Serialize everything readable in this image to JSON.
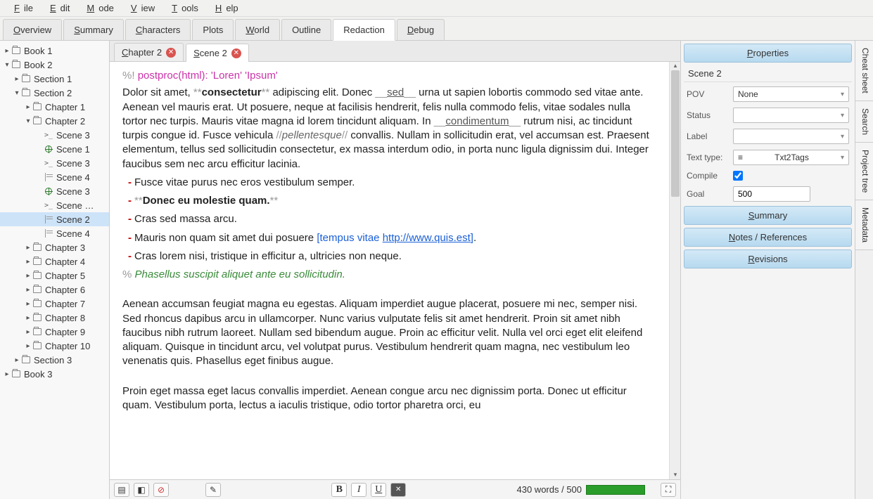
{
  "menu": [
    "File",
    "Edit",
    "Mode",
    "View",
    "Tools",
    "Help"
  ],
  "mainTabs": [
    "Overview",
    "Summary",
    "Characters",
    "Plots",
    "World",
    "Outline",
    "Redaction",
    "Debug"
  ],
  "activeMainTab": 6,
  "tree": [
    {
      "d": 0,
      "exp": "▸",
      "ico": "folder",
      "label": "Book 1"
    },
    {
      "d": 0,
      "exp": "▾",
      "ico": "folder",
      "label": "Book 2"
    },
    {
      "d": 1,
      "exp": "▸",
      "ico": "folder",
      "label": "Section 1"
    },
    {
      "d": 1,
      "exp": "▾",
      "ico": "folder",
      "label": "Section 2"
    },
    {
      "d": 2,
      "exp": "▸",
      "ico": "folder",
      "label": "Chapter 1"
    },
    {
      "d": 2,
      "exp": "▾",
      "ico": "folder",
      "label": "Chapter 2"
    },
    {
      "d": 3,
      "exp": "",
      "ico": "prompt",
      "label": "Scene 3"
    },
    {
      "d": 3,
      "exp": "",
      "ico": "globe",
      "label": "Scene 1"
    },
    {
      "d": 3,
      "exp": "",
      "ico": "prompt",
      "label": "Scene 3"
    },
    {
      "d": 3,
      "exp": "",
      "ico": "lined",
      "label": "Scene 4"
    },
    {
      "d": 3,
      "exp": "",
      "ico": "globe",
      "label": "Scene 3"
    },
    {
      "d": 3,
      "exp": "",
      "ico": "prompt",
      "label": "Scene …"
    },
    {
      "d": 3,
      "exp": "",
      "ico": "lined",
      "label": "Scene 2",
      "sel": true
    },
    {
      "d": 3,
      "exp": "",
      "ico": "lined",
      "label": "Scene 4"
    },
    {
      "d": 2,
      "exp": "▸",
      "ico": "folder",
      "label": "Chapter 3"
    },
    {
      "d": 2,
      "exp": "▸",
      "ico": "folder",
      "label": "Chapter 4"
    },
    {
      "d": 2,
      "exp": "▸",
      "ico": "folder",
      "label": "Chapter 5"
    },
    {
      "d": 2,
      "exp": "▸",
      "ico": "folder",
      "label": "Chapter 6"
    },
    {
      "d": 2,
      "exp": "▸",
      "ico": "folder",
      "label": "Chapter 7"
    },
    {
      "d": 2,
      "exp": "▸",
      "ico": "folder",
      "label": "Chapter 8"
    },
    {
      "d": 2,
      "exp": "▸",
      "ico": "folder",
      "label": "Chapter 9"
    },
    {
      "d": 2,
      "exp": "▸",
      "ico": "folder",
      "label": "Chapter 10"
    },
    {
      "d": 1,
      "exp": "▸",
      "ico": "folder",
      "label": "Section 3"
    },
    {
      "d": 0,
      "exp": "▸",
      "ico": "folder",
      "label": "Book 3"
    }
  ],
  "editorTabs": [
    {
      "label": "Chapter 2",
      "active": false
    },
    {
      "label": "Scene 2",
      "active": true
    }
  ],
  "content": {
    "postproc_pre": "%! ",
    "postproc": "postproc(html): 'Loren' 'Ipsum'",
    "p1_a": "    Dolor sit amet, ",
    "p1_stars1": "**",
    "p1_bold": "consectetur",
    "p1_stars2": "**",
    "p1_b": " adipiscing elit. Donec ",
    "p1_u1": "__",
    "p1_sed": "sed",
    "p1_u2": "__",
    "p1_c": " urna ut sapien lobortis commodo sed vitae ante. Aenean vel mauris erat. Ut posuere, neque at facilisis hendrerit, felis nulla commodo felis, vitae sodales nulla tortor nec turpis. Mauris vitae magna id lorem tincidunt aliquam. In ",
    "p1_u3": "__",
    "p1_cond": "condimentum",
    "p1_u4": "__",
    "p1_d": " rutrum nisi, ac tincidunt turpis congue id. Fusce vehicula ",
    "p1_sl1": "//",
    "p1_it": "pellentesque",
    "p1_sl2": "//",
    "p1_e": " convallis. Nullam in sollicitudin erat, vel accumsan est. Praesent elementum, tellus sed sollicitudin consectetur, ex massa interdum odio, in porta nunc ligula dignissim dui. Integer faucibus sem nec arcu efficitur lacinia.",
    "b1": "Fusce vitae purus nec eros vestibulum semper.",
    "b2_s1": "**",
    "b2_bold": "Donec eu molestie quam.",
    "b2_s2": "**",
    "b3": "Cras sed massa arcu.",
    "b4_a": "Mauris non quam sit amet dui posuere ",
    "b4_br": "[",
    "b4_txt": "tempus vitae ",
    "b4_link": "http://www.quis.est",
    "b4_br2": "]",
    "b4_dot": ".",
    "b5": "Cras lorem nisi, tristique in efficitur a, ultricies non neque.",
    "comment_pre": "% ",
    "comment": "Phasellus suscipit aliquet ante eu sollicitudin.",
    "p2": "    Aenean accumsan feugiat magna eu egestas. Aliquam imperdiet augue placerat, posuere mi nec, semper nisi. Sed rhoncus dapibus arcu in ullamcorper. Nunc varius vulputate felis sit amet hendrerit. Proin sit amet nibh faucibus nibh rutrum laoreet. Nullam sed bibendum augue. Proin ac efficitur velit. Nulla vel orci eget elit eleifend aliquam. Quisque in tincidunt arcu, vel volutpat purus. Vestibulum hendrerit quam magna, nec vestibulum leo venenatis quis. Phasellus eget finibus augue.",
    "p3": "    Proin eget massa eget lacus convallis imperdiet. Aenean congue arcu nec dignissim porta. Donec ut efficitur quam. Vestibulum porta, lectus a iaculis tristique, odio tortor pharetra orci, eu"
  },
  "status": {
    "words": "430 words / 500"
  },
  "props": {
    "headers": {
      "properties": "Properties",
      "summary": "Summary",
      "notes": "Notes / References",
      "revisions": "Revisions"
    },
    "title": "Scene 2",
    "labels": {
      "pov": "POV",
      "status": "Status",
      "label": "Label",
      "texttype": "Text type:",
      "compile": "Compile",
      "goal": "Goal"
    },
    "pov": "None",
    "status": "",
    "labelv": "",
    "texttype": "Txt2Tags",
    "goal": "500"
  },
  "rail": [
    "Cheat sheet",
    "Search",
    "Project tree",
    "Metadata"
  ]
}
